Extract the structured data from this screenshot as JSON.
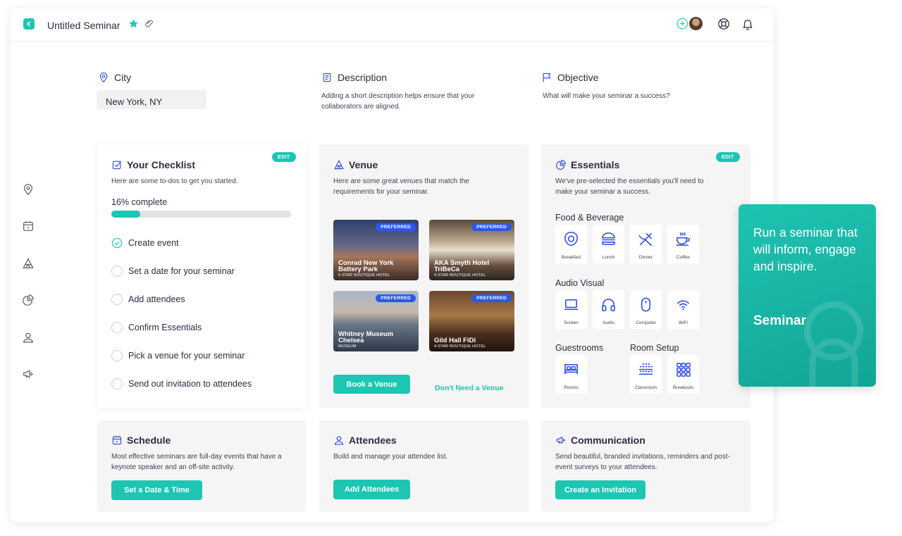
{
  "header": {
    "title": "Untitled Seminar"
  },
  "city": {
    "label": "City",
    "value": "New York, NY"
  },
  "description": {
    "label": "Description",
    "help": "Adding a short description helps ensure that your collaborators are aligned."
  },
  "objective": {
    "label": "Objective",
    "help": "What will make your seminar a success?"
  },
  "checklist": {
    "title": "Your Checklist",
    "subtitle": "Here are some to-dos to get you started.",
    "edit": "EDIT",
    "progress_label": "16% complete",
    "progress": 0.16,
    "tasks": [
      {
        "label": "Create event",
        "done": true
      },
      {
        "label": "Set a date for your seminar",
        "done": false
      },
      {
        "label": "Add attendees",
        "done": false
      },
      {
        "label": "Confirm Essentials",
        "done": false
      },
      {
        "label": "Pick a venue for your seminar",
        "done": false
      },
      {
        "label": "Send out invitation to attendees",
        "done": false
      }
    ]
  },
  "venue": {
    "title": "Venue",
    "subtitle": "Here are some great venues that match the requirements for your seminar.",
    "venues": [
      {
        "name": "Conrad New York Battery Park",
        "type": "5-STAR BOUTIQUE HOTEL",
        "badge": "PREFERRED"
      },
      {
        "name": "AKA Smyth Hotel TriBeCa",
        "type": "4-STAR BOUTIQUE HOTEL",
        "badge": "PREFERRED"
      },
      {
        "name": "Whitney Museum Chelsea",
        "type": "MUSEUM",
        "badge": "PREFERRED"
      },
      {
        "name": "Gild Hall FiDi",
        "type": "4-STAR BOUTIQUE HOTEL",
        "badge": "PREFERRED"
      }
    ],
    "book_button": "Book a Venue",
    "skip_link": "Don't Need a Venue"
  },
  "essentials": {
    "title": "Essentials",
    "subtitle": "We've pre-selected the essentials you'll need to make your seminar a success.",
    "edit": "EDIT",
    "food_heading": "Food & Beverage",
    "food": [
      "Breakfast",
      "Lunch",
      "Dinner",
      "Coffee"
    ],
    "av_heading": "Audio Visual",
    "av": [
      "Screen",
      "Audio",
      "Computer",
      "WiFi"
    ],
    "guest_heading": "Guestrooms",
    "guest": [
      "Rooms"
    ],
    "setup_heading": "Room Setup",
    "setup": [
      "Classroom",
      "Breakouts"
    ]
  },
  "schedule": {
    "title": "Schedule",
    "subtitle": "Most effective seminars are full-day events that have a keynote speaker and an off-site activity.",
    "button": "Set a Date & Time"
  },
  "attendees": {
    "title": "Attendees",
    "subtitle": "Build and manage your attendee list.",
    "button": "Add Attendees"
  },
  "communication": {
    "title": "Communication",
    "subtitle": "Send beautiful, branded invitations, reminders and post-event surveys to your attendees.",
    "button": "Create an Invitation"
  },
  "promo": {
    "text": "Run a seminar that will inform, engage and inspire.",
    "title": "Seminar"
  },
  "colors": {
    "accent": "#1cc6b3",
    "icon": "#2a4be0",
    "badge": "#2a59e8"
  }
}
